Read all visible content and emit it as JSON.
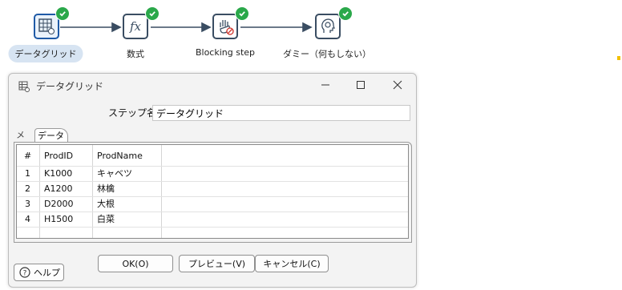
{
  "pipeline": {
    "steps": [
      {
        "label": "データグリッド",
        "icon": "data-grid-icon",
        "selected": true,
        "status": "ok"
      },
      {
        "label": "数式",
        "icon": "formula-icon",
        "selected": false,
        "status": "ok"
      },
      {
        "label": "Blocking step",
        "icon": "blocking-hand-icon",
        "selected": false,
        "status": "ok"
      },
      {
        "label": "ダミー（何もしない）",
        "icon": "dummy-head-icon",
        "selected": false,
        "status": "ok"
      }
    ]
  },
  "dialog": {
    "title": "データグリッド",
    "step_name_label": "ステップ名",
    "step_name_value": "データグリッド",
    "tabs": [
      {
        "label": "メタ",
        "active": false
      },
      {
        "label": "データ",
        "active": true
      }
    ],
    "table": {
      "columns": [
        "#",
        "ProdID",
        "ProdName"
      ],
      "rows": [
        [
          "1",
          "K1000",
          "キャベツ"
        ],
        [
          "2",
          "A1200",
          "林檎"
        ],
        [
          "3",
          "D2000",
          "大根"
        ],
        [
          "4",
          "H1500",
          "白菜"
        ]
      ]
    },
    "buttons": {
      "ok": "OK(O)",
      "preview": "プレビュー(V)",
      "cancel": "キャンセル(C)",
      "help": "ヘルプ"
    }
  },
  "colors": {
    "accent": "#1f5aa6",
    "check": "#2aa84a",
    "selected_label_bg": "#d7e4f2"
  }
}
